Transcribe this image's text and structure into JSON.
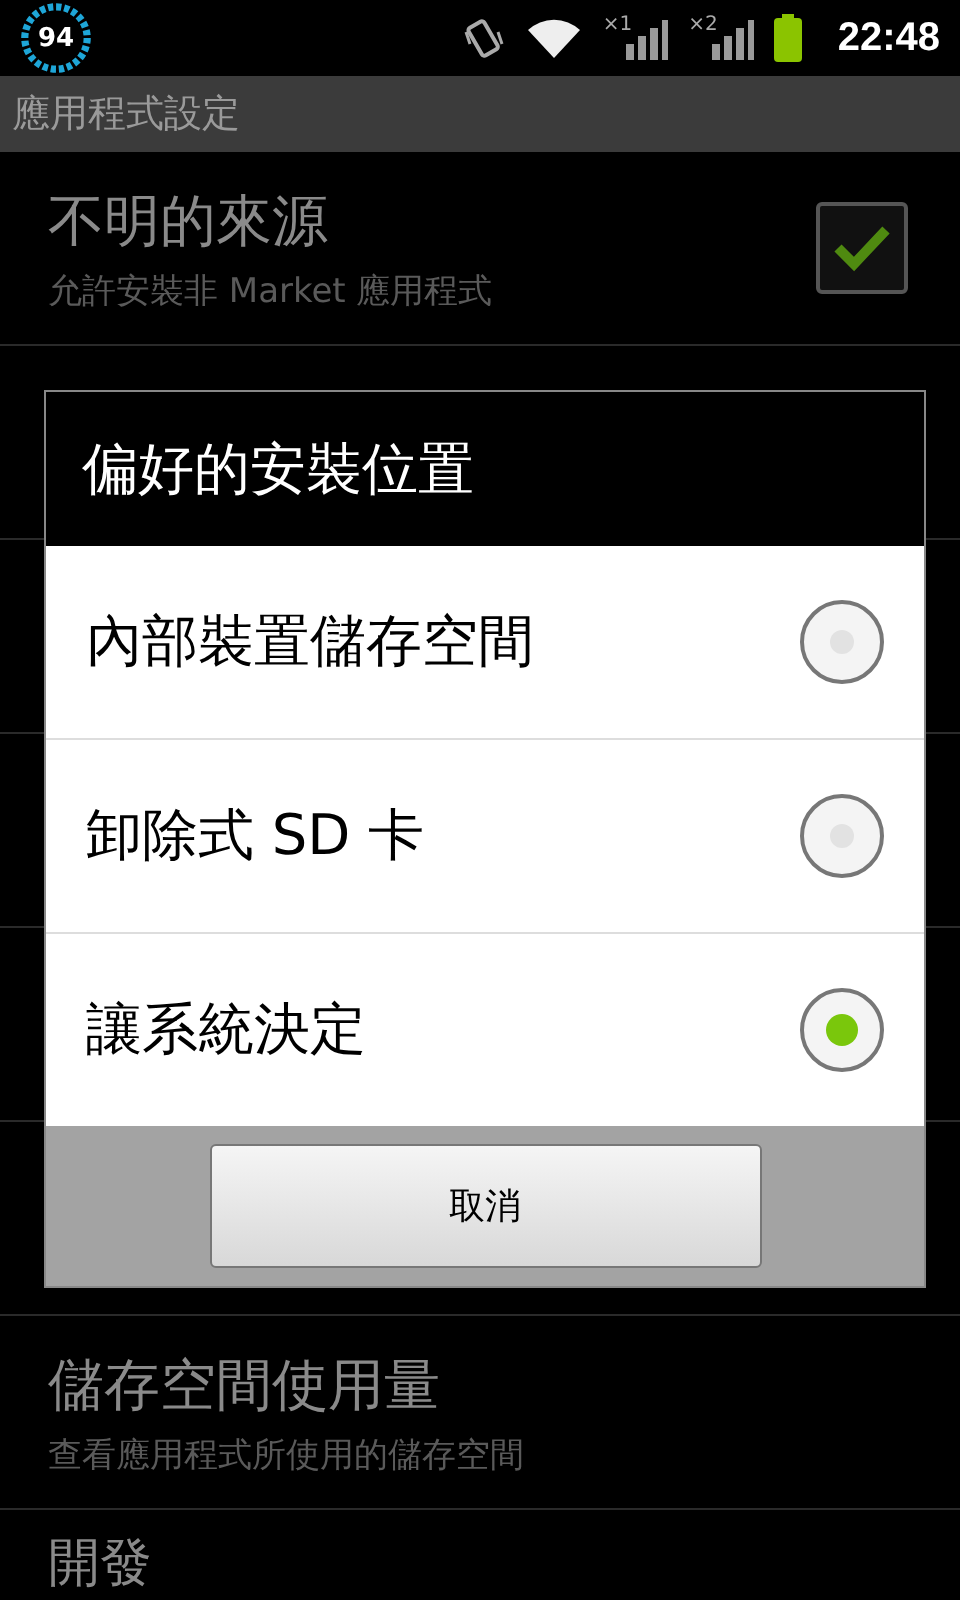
{
  "status_bar": {
    "widget_value": "94",
    "signal_labels": [
      "×1",
      "×2"
    ],
    "time": "22:48"
  },
  "title_bar": {
    "title": "應用程式設定"
  },
  "settings": [
    {
      "title": "不明的來源",
      "subtitle": "允許安裝非 Market 應用程式",
      "checked": true
    }
  ],
  "settings_below": [
    {
      "title": "儲存空間使用量",
      "subtitle": "查看應用程式所使用的儲存空間"
    },
    {
      "title": "開發"
    }
  ],
  "dialog": {
    "title": "偏好的安裝位置",
    "options": [
      {
        "label": "內部裝置儲存空間",
        "selected": false
      },
      {
        "label": "卸除式 SD 卡",
        "selected": false
      },
      {
        "label": "讓系統決定",
        "selected": true
      }
    ],
    "cancel": "取消"
  }
}
